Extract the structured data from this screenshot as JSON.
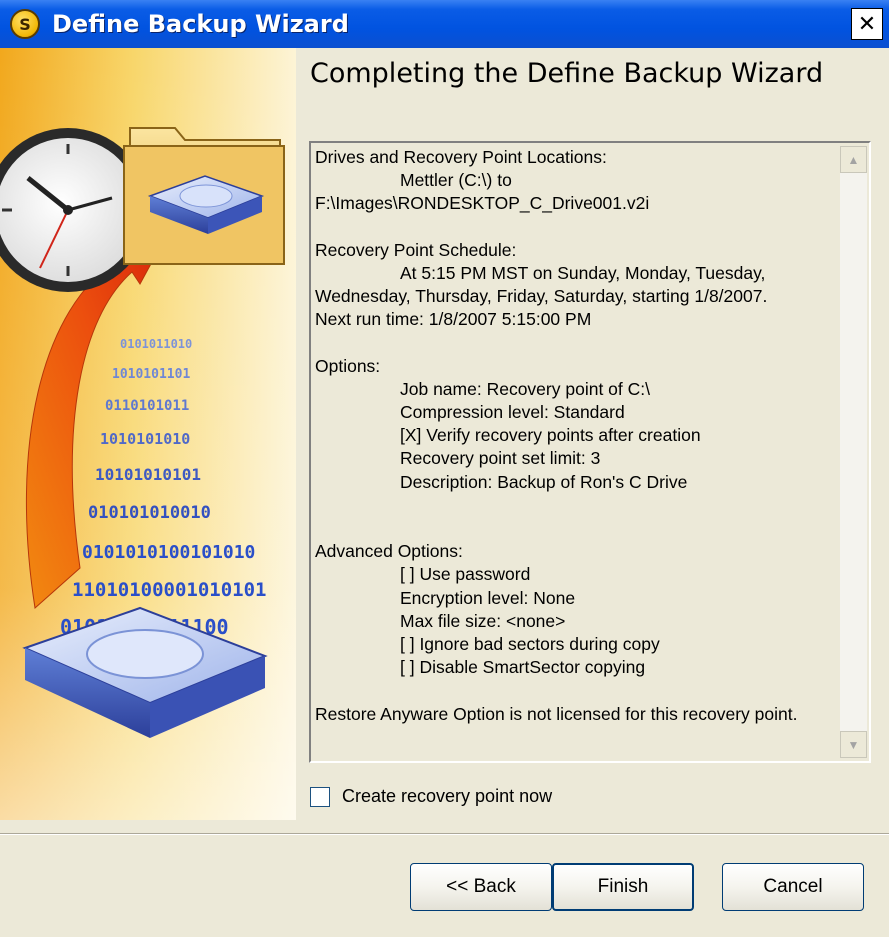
{
  "window": {
    "title": "Define Backup Wizard",
    "app_icon_glyph": "S",
    "close_glyph": "✕"
  },
  "heading": "Completing the Define Backup Wizard",
  "sidebar": {
    "icons": [
      "clock-icon",
      "folder-icon",
      "hard-drive-icon",
      "arrow-icon"
    ],
    "digit_rows": [
      "0101011010",
      "1010101101",
      "0110101011",
      "1010101010",
      "10101010101",
      "010101010010",
      "0101010100101010",
      "11010100001010101",
      "01010101111100"
    ]
  },
  "summary": {
    "lines": [
      {
        "text": "Drives and Recovery Point Locations:",
        "indent": false
      },
      {
        "text": "Mettler (C:\\) to",
        "indent": true
      },
      {
        "text": "F:\\Images\\RONDESKTOP_C_Drive001.v2i",
        "indent": false
      },
      {
        "text": "",
        "indent": false
      },
      {
        "text": "Recovery Point Schedule:",
        "indent": false
      },
      {
        "text": "At 5:15 PM MST on Sunday, Monday, Tuesday,",
        "indent": true
      },
      {
        "text": "Wednesday, Thursday, Friday, Saturday, starting 1/8/2007.",
        "indent": false
      },
      {
        "text": "Next run time: 1/8/2007 5:15:00 PM",
        "indent": false
      },
      {
        "text": "",
        "indent": false
      },
      {
        "text": "Options:",
        "indent": false
      },
      {
        "text": "Job name: Recovery point of C:\\",
        "indent": true
      },
      {
        "text": "Compression level: Standard",
        "indent": true
      },
      {
        "text": "[X] Verify recovery points after creation",
        "indent": true
      },
      {
        "text": "Recovery point set limit: 3",
        "indent": true
      },
      {
        "text": "Description: Backup of Ron's C Drive",
        "indent": true
      },
      {
        "text": "",
        "indent": false
      },
      {
        "text": "",
        "indent": false
      },
      {
        "text": "Advanced Options:",
        "indent": false
      },
      {
        "text": "[ ] Use password",
        "indent": true
      },
      {
        "text": "Encryption level: None",
        "indent": true
      },
      {
        "text": "Max file size: <none>",
        "indent": true
      },
      {
        "text": "[ ] Ignore bad sectors during copy",
        "indent": true
      },
      {
        "text": "[ ] Disable SmartSector copying",
        "indent": true
      },
      {
        "text": "",
        "indent": false
      },
      {
        "text": "Restore Anyware Option is not licensed for this recovery point.",
        "indent": false
      }
    ],
    "scroll_up_glyph": "▲",
    "scroll_down_glyph": "▼"
  },
  "checkbox": {
    "label": "Create recovery point now",
    "checked": false
  },
  "buttons": {
    "back": "<< Back",
    "finish": "Finish",
    "cancel": "Cancel"
  }
}
